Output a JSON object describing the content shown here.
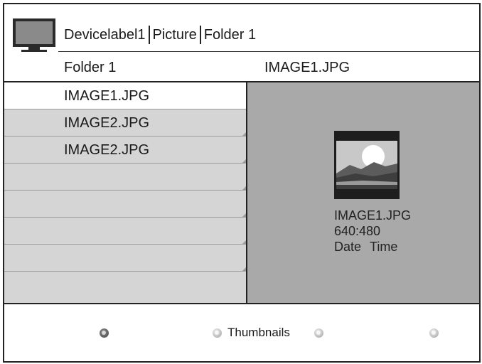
{
  "header": {
    "breadcrumb": [
      "Devicelabel1",
      "Picture",
      "Folder 1"
    ]
  },
  "columns": {
    "left_title": "Folder 1",
    "right_title": "IMAGE1.JPG"
  },
  "file_list": {
    "items": [
      {
        "label": "IMAGE1.JPG",
        "selected": true
      },
      {
        "label": "IMAGE2.JPG",
        "selected": false
      },
      {
        "label": "IMAGE2.JPG",
        "selected": false
      },
      {
        "label": "",
        "selected": false
      },
      {
        "label": "",
        "selected": false
      },
      {
        "label": "",
        "selected": false
      },
      {
        "label": "",
        "selected": false
      },
      {
        "label": "",
        "selected": false
      }
    ]
  },
  "preview": {
    "filename": "IMAGE1.JPG",
    "resolution": "640:480",
    "date": "Date",
    "time": "Time"
  },
  "color_keys": [
    {
      "color": "dark",
      "label": ""
    },
    {
      "color": "light",
      "label": "Thumbnails"
    },
    {
      "color": "light",
      "label": ""
    },
    {
      "color": "light",
      "label": ""
    }
  ]
}
